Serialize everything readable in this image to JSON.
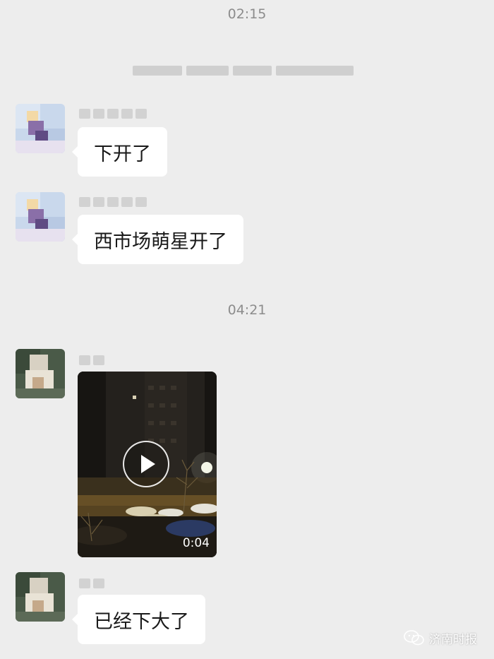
{
  "chat": {
    "timestamps": [
      "02:15",
      "04:21"
    ],
    "messages": [
      {
        "type": "text",
        "text": "下开了"
      },
      {
        "type": "text",
        "text": "西市场萌星开了"
      },
      {
        "type": "video",
        "duration": "0:04"
      },
      {
        "type": "text",
        "text": "已经下大了"
      }
    ]
  },
  "watermark": {
    "text": "济南时报",
    "icon": "wechat-logo-icon"
  },
  "colors": {
    "background": "#ededed",
    "bubble": "#ffffff",
    "timestamp": "#8c8c8c"
  }
}
